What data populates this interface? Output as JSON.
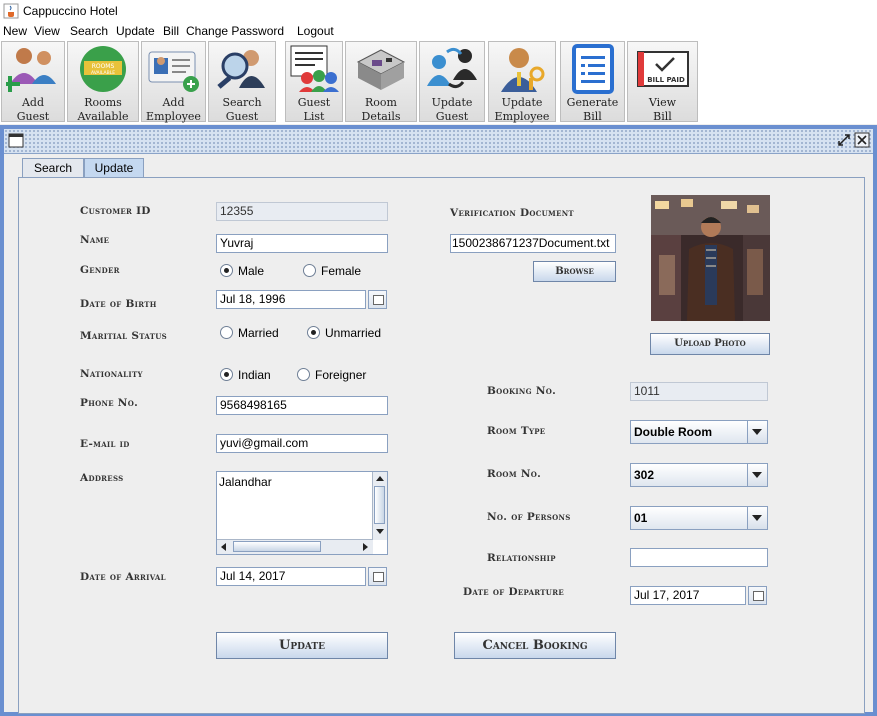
{
  "window": {
    "title": "Cappuccino Hotel"
  },
  "menu": [
    "New",
    "View",
    "Search",
    "Update",
    "Bill",
    "Change Password",
    "Logout"
  ],
  "toolbar": [
    {
      "label": "Add\nGuest",
      "icon": "add-guest-icon"
    },
    {
      "label": "Rooms\nAvailable",
      "icon": "rooms-available-icon",
      "badge": "ROOMS\nAVAILABLE"
    },
    {
      "label": "Add\nEmployee",
      "icon": "add-employee-icon"
    },
    {
      "label": "Search\nGuest",
      "icon": "search-guest-icon"
    },
    {
      "label": "Guest\nList",
      "icon": "guest-list-icon"
    },
    {
      "label": "Room\nDetails",
      "icon": "room-details-icon"
    },
    {
      "label": "Update\nGuest",
      "icon": "update-guest-icon"
    },
    {
      "label": "Update\nEmployee",
      "icon": "update-employee-icon"
    },
    {
      "label": "Generate\nBill",
      "icon": "generate-bill-icon"
    },
    {
      "label": "View\nBill",
      "icon": "view-bill-icon",
      "badge": "BILL PAID"
    }
  ],
  "tabs": {
    "search": "Search",
    "update": "Update",
    "active": "Update"
  },
  "form": {
    "customer_id_label": "Customer ID",
    "customer_id": "12355",
    "name_label": "Name",
    "name": "Yuvraj",
    "gender_label": "Gender",
    "gender_male": "Male",
    "gender_female": "Female",
    "gender_selected": "Male",
    "dob_label": "Date of Birth",
    "dob": "Jul 18, 1996",
    "marital_label": "Maritial Status",
    "marital_married": "Married",
    "marital_unmarried": "Unmarried",
    "marital_selected": "Unmarried",
    "nationality_label": "Nationality",
    "nationality_indian": "Indian",
    "nationality_foreigner": "Foreigner",
    "nationality_selected": "Indian",
    "phone_label": "Phone No.",
    "phone": "9568498165",
    "email_label": "E-mail id",
    "email": "yuvi@gmail.com",
    "address_label": "Address",
    "address": "Jalandhar",
    "arrival_label": "Date of Arrival",
    "arrival": "Jul 14, 2017",
    "verification_label": "Verification Document",
    "verification_file": "1500238671237Document.txt",
    "browse": "Browse",
    "upload_photo": "Upload Photo",
    "booking_no_label": "Booking No.",
    "booking_no": "1011",
    "room_type_label": "Room Type",
    "room_type": "Double Room",
    "room_no_label": "Room No.",
    "room_no": "302",
    "persons_label": "No. of Persons",
    "persons": "01",
    "relationship_label": "Relationship",
    "relationship": "",
    "departure_label": "Date of Departure",
    "departure": "Jul 17, 2017",
    "update_button": "Update",
    "cancel_button": "Cancel Booking"
  },
  "colors": {
    "frame_border": "#6a8fd0",
    "button_top": "#ffffff",
    "button_bottom": "#c9d8ec"
  }
}
